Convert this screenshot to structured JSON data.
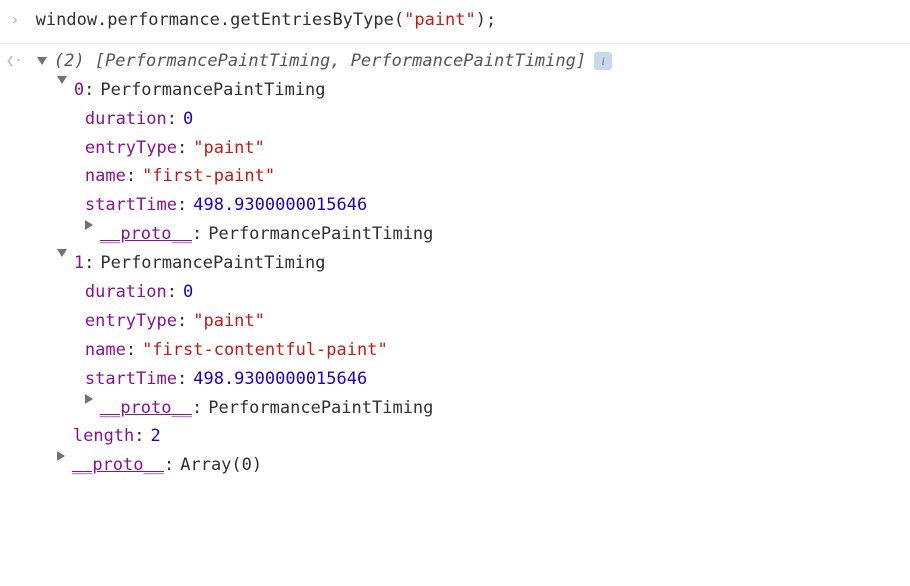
{
  "input": {
    "code_prefix": "window.performance.getEntriesByType(",
    "code_string": "\"paint\"",
    "code_suffix": ");"
  },
  "output": {
    "summary_count": "(2)",
    "summary_types": "[PerformancePaintTiming, PerformancePaintTiming]",
    "info_badge": "i",
    "entries": [
      {
        "index": "0",
        "type": "PerformancePaintTiming",
        "props": {
          "duration_key": "duration",
          "duration_val": "0",
          "entryType_key": "entryType",
          "entryType_val": "\"paint\"",
          "name_key": "name",
          "name_val": "\"first-paint\"",
          "startTime_key": "startTime",
          "startTime_val": "498.9300000015646",
          "proto_key": "__proto__",
          "proto_val": "PerformancePaintTiming"
        }
      },
      {
        "index": "1",
        "type": "PerformancePaintTiming",
        "props": {
          "duration_key": "duration",
          "duration_val": "0",
          "entryType_key": "entryType",
          "entryType_val": "\"paint\"",
          "name_key": "name",
          "name_val": "\"first-contentful-paint\"",
          "startTime_key": "startTime",
          "startTime_val": "498.9300000015646",
          "proto_key": "__proto__",
          "proto_val": "PerformancePaintTiming"
        }
      }
    ],
    "length_key": "length",
    "length_val": "2",
    "array_proto_key": "__proto__",
    "array_proto_val": "Array(0)"
  }
}
